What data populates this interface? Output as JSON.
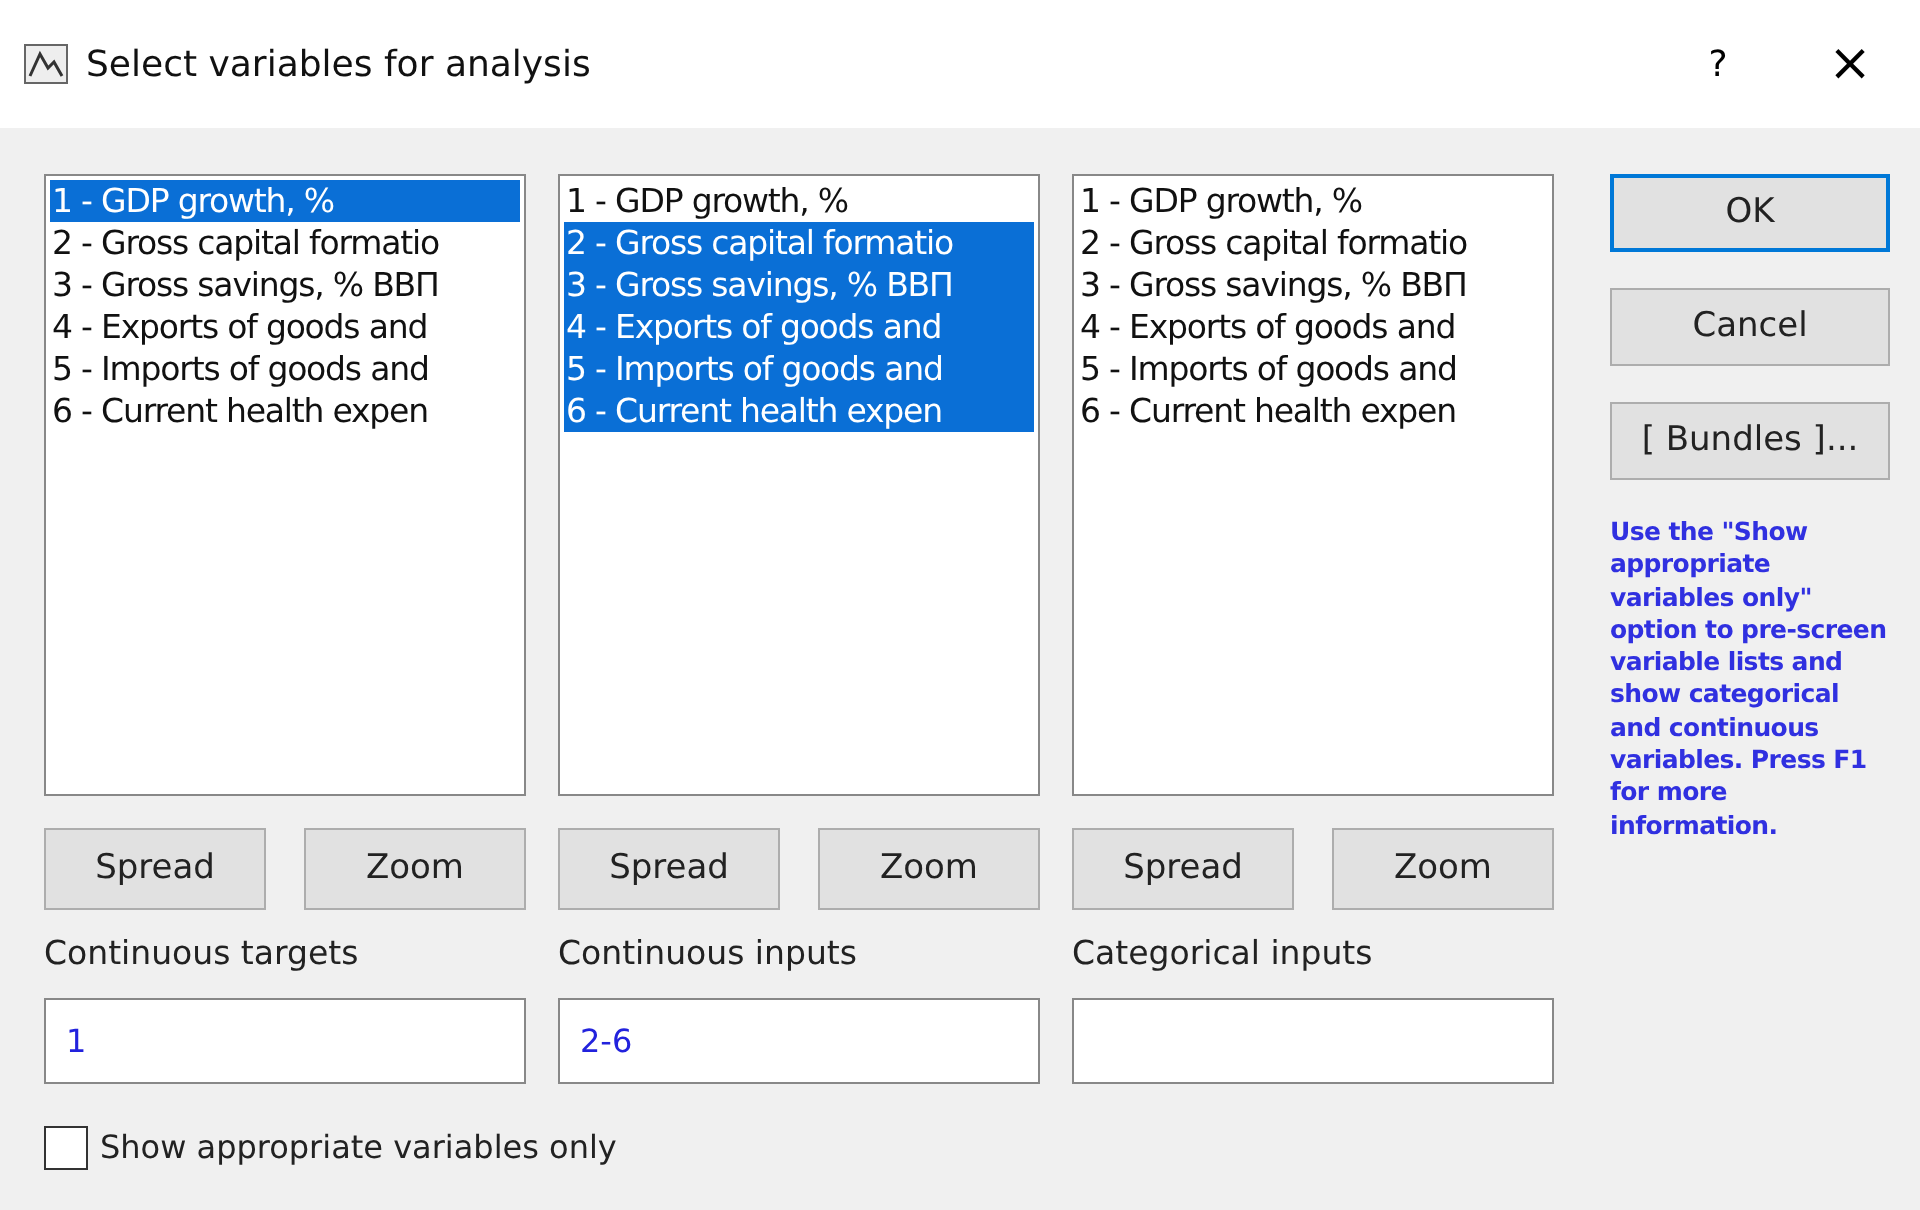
{
  "window": {
    "title": "Select variables for analysis",
    "help": "?",
    "close": "×"
  },
  "lists": [
    {
      "items": [
        {
          "text": "1 - GDP growth, %",
          "selected": true
        },
        {
          "text": "2 - Gross capital formatio",
          "selected": false
        },
        {
          "text": "3 - Gross savings, % ВВП",
          "selected": false
        },
        {
          "text": "4 - Exports of goods and",
          "selected": false
        },
        {
          "text": "5 - Imports of goods and",
          "selected": false
        },
        {
          "text": "6 - Current health expen",
          "selected": false
        }
      ],
      "buttons": [
        "Spread",
        "Zoom"
      ],
      "label": "Continuous targets",
      "value": "1"
    },
    {
      "items": [
        {
          "text": "1 - GDP growth, %",
          "selected": false
        },
        {
          "text": "2 - Gross capital formatio",
          "selected": true
        },
        {
          "text": "3 - Gross savings, % ВВП",
          "selected": true
        },
        {
          "text": "4 - Exports of goods and",
          "selected": true
        },
        {
          "text": "5 - Imports of goods and",
          "selected": true
        },
        {
          "text": "6 - Current health expen",
          "selected": true
        }
      ],
      "buttons": [
        "Spread",
        "Zoom"
      ],
      "label": "Continuous inputs",
      "value": "2-6"
    },
    {
      "items": [
        {
          "text": "1 - GDP growth, %",
          "selected": false
        },
        {
          "text": "2 - Gross capital formatio",
          "selected": false
        },
        {
          "text": "3 - Gross savings, % ВВП",
          "selected": false
        },
        {
          "text": "4 - Exports of goods and",
          "selected": false
        },
        {
          "text": "5 - Imports of goods and",
          "selected": false
        },
        {
          "text": "6 - Current health expen",
          "selected": false
        }
      ],
      "buttons": [
        "Spread",
        "Zoom"
      ],
      "label": "Categorical inputs"
    }
  ],
  "buttons": [
    {
      "label": "OK",
      "default": true
    },
    {
      "label": "Cancel",
      "default": false
    },
    {
      "label": "[ Bundles ]...",
      "default": false
    }
  ],
  "help_text": "Use the \"Show appropriate variables only\" option to pre-screen variable lists and show categorical and continuous variables. Press F1 for more information.",
  "checkbox": {
    "label": "Show appropriate variables only",
    "checked": false
  }
}
